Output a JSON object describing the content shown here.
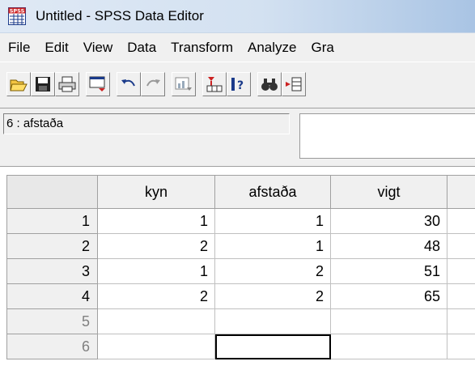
{
  "window": {
    "title": "Untitled - SPSS Data Editor",
    "icon": "spss-app-icon",
    "icon_label": "SPSS"
  },
  "menu": [
    "File",
    "Edit",
    "View",
    "Data",
    "Transform",
    "Analyze",
    "Gra"
  ],
  "toolbar": {
    "buttons": [
      "open-icon",
      "save-icon",
      "print-icon",
      "dialog-recall-icon",
      "undo-icon",
      "redo-icon",
      "goto-chart-icon",
      "goto-case-icon",
      "variables-icon",
      "find-icon",
      "insert-cases-icon"
    ]
  },
  "cell_editor": {
    "reference": "6 : afstaða",
    "value": ""
  },
  "grid": {
    "columns": [
      "kyn",
      "afstaða",
      "vigt"
    ],
    "rows": [
      {
        "num": "1",
        "cells": [
          "1",
          "1",
          "30"
        ]
      },
      {
        "num": "2",
        "cells": [
          "2",
          "1",
          "48"
        ]
      },
      {
        "num": "3",
        "cells": [
          "1",
          "2",
          "51"
        ]
      },
      {
        "num": "4",
        "cells": [
          "2",
          "2",
          "65"
        ]
      },
      {
        "num": "5",
        "cells": [
          "",
          "",
          ""
        ]
      },
      {
        "num": "6",
        "cells": [
          "",
          "",
          ""
        ]
      }
    ]
  },
  "colors": {
    "window_frame": "#d3e1f1",
    "face": "#f0f0f0",
    "grid_line": "#c0c0c0",
    "inactive_row_number": "#808080"
  }
}
